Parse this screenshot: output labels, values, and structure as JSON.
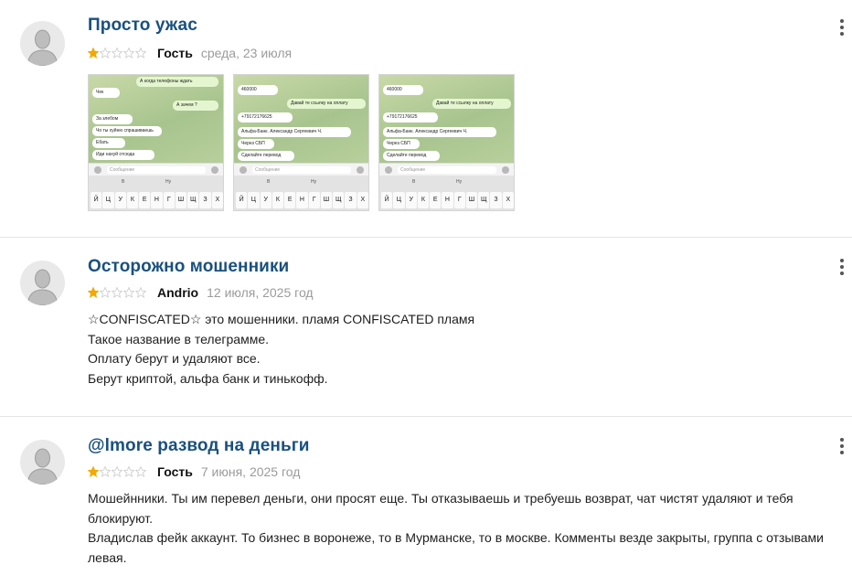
{
  "reviews": [
    {
      "title": "Просто ужас",
      "rating": 1,
      "author": "Гость",
      "date": "среда, 23 июля",
      "body": [],
      "attachments": [
        {
          "bubbles": [
            {
              "text": "А когда телефоны ждать",
              "dir": "out"
            },
            {
              "text": "Чек",
              "dir": "in"
            },
            {
              "text": "А зачем ?",
              "dir": "out"
            },
            {
              "text": "За злебом",
              "dir": "in"
            },
            {
              "text": "Чо ты хуйню спрашиваешь",
              "dir": "in"
            },
            {
              "text": "Ебать",
              "dir": "in"
            },
            {
              "text": "Иди нахуй отсюда",
              "dir": "in"
            }
          ]
        },
        {
          "bubbles": [
            {
              "text": "460000",
              "dir": "in"
            },
            {
              "text": "Давай те ссылку на оплату",
              "dir": "out"
            },
            {
              "text": "+79172176625",
              "dir": "in"
            },
            {
              "text": "Альфа-Банк. Александр Сергеевич Ч.",
              "dir": "in"
            },
            {
              "text": "Через СБП",
              "dir": "in"
            },
            {
              "text": "Сделайте перевод",
              "dir": "in"
            }
          ]
        },
        {
          "bubbles": [
            {
              "text": "460000",
              "dir": "in"
            },
            {
              "text": "Давай те ссылку на оплату",
              "dir": "out"
            },
            {
              "text": "+79172176625",
              "dir": "in"
            },
            {
              "text": "Альфа-Банк. Александр Сергеевич Ч.",
              "dir": "in"
            },
            {
              "text": "Через СБП",
              "dir": "in"
            },
            {
              "text": "Сделайте перевод",
              "dir": "in"
            }
          ]
        }
      ]
    },
    {
      "title": "Осторожно мошенники",
      "rating": 1,
      "author": "Andrio",
      "date": "12 июля, 2025 год",
      "body": [
        "☆CONFISCATED☆ это мошенники. пламя CONFISCATED пламя",
        "Такое название в телеграмме.",
        "Оплату берут и удаляют все.",
        "Берут криптой, альфа банк и тинькофф."
      ],
      "attachments": []
    },
    {
      "title": "@lmore развод на деньги",
      "rating": 1,
      "author": "Гость",
      "date": "7 июня, 2025 год",
      "body": [
        "Мошейнники. Ты им перевел деньги, они просят еще. Ты отказываешь и требуешь возврат, чат чистят удаляют и тебя блокируют.",
        "Владислав фейк аккаунт. То бизнес в воронеже, то в Мурманске, то в москве. Комменты везде закрыты, группа с отзывами левая."
      ],
      "attachments": []
    }
  ],
  "keyboard": {
    "keys": [
      "Й",
      "Ц",
      "У",
      "К",
      "Е",
      "Н",
      "Г",
      "Ш",
      "Щ",
      "З",
      "Х"
    ],
    "suggestions": [
      "В",
      "Ну"
    ],
    "input_placeholder": "Сообщение"
  },
  "colors": {
    "title": "#19507f",
    "star_filled": "#f2a900",
    "star_empty": "#cfcfcf"
  },
  "icons": {
    "avatar": "default-user-avatar-icon",
    "menu": "more-vertical-icon",
    "star": "star-icon"
  }
}
